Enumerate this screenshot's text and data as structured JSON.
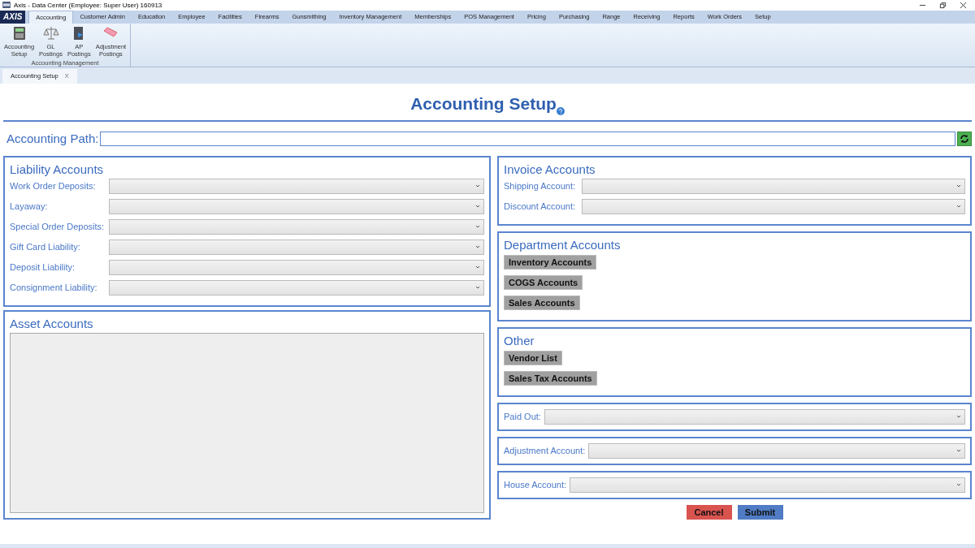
{
  "window": {
    "title": "Axis - Data Center  (Employee: Super User) 160913",
    "logo": "AXIS"
  },
  "menu_tabs": [
    {
      "label": "Accounting",
      "selected": true
    },
    {
      "label": "Customer Admin",
      "selected": false
    },
    {
      "label": "Education",
      "selected": false
    },
    {
      "label": "Employee",
      "selected": false
    },
    {
      "label": "Facilities",
      "selected": false
    },
    {
      "label": "Firearms",
      "selected": false
    },
    {
      "label": "Gunsmithing",
      "selected": false
    },
    {
      "label": "Inventory Management",
      "selected": false
    },
    {
      "label": "Memberships",
      "selected": false
    },
    {
      "label": "POS Management",
      "selected": false
    },
    {
      "label": "Pricing",
      "selected": false
    },
    {
      "label": "Purchasing",
      "selected": false
    },
    {
      "label": "Range",
      "selected": false
    },
    {
      "label": "Receiving",
      "selected": false
    },
    {
      "label": "Reports",
      "selected": false
    },
    {
      "label": "Work Orders",
      "selected": false
    },
    {
      "label": "Setup",
      "selected": false
    }
  ],
  "ribbon": {
    "group_label": "Accounting Management",
    "buttons": [
      {
        "kind": "calculator",
        "label": "Accounting\nSetup"
      },
      {
        "kind": "scale",
        "label": "GL\nPostings"
      },
      {
        "kind": "book",
        "label": "AP\nPostings"
      },
      {
        "kind": "eraser",
        "label": "Adjustment\nPostings"
      }
    ]
  },
  "document_tabs": [
    {
      "label": "Accounting Setup",
      "close": "X",
      "selected": true
    }
  ],
  "page_title": "Accounting Setup",
  "accounting_path": {
    "label": "Accounting Path:"
  },
  "liability_accounts": {
    "title": "Liability Accounts",
    "fields": [
      "Work Order Deposits:",
      "Layaway:",
      "Special Order Deposits:",
      "Gift Card Liability:",
      "Deposit Liability:",
      "Consignment Liability:"
    ]
  },
  "asset_accounts": {
    "title": "Asset Accounts"
  },
  "invoice_accounts": {
    "title": "Invoice Accounts",
    "fields": [
      "Shipping Account:",
      "Discount Account:"
    ]
  },
  "department_accounts": {
    "title": "Department Accounts",
    "buttons": [
      "Inventory Accounts",
      "COGS Accounts",
      "Sales Accounts"
    ]
  },
  "other": {
    "title": "Other",
    "buttons": [
      "Vendor List",
      "Sales Tax Accounts"
    ]
  },
  "single_fields": [
    "Paid Out:",
    "Adjustment Account:",
    "House Account:"
  ],
  "actions": [
    {
      "kind": "cancel",
      "label": "Cancel"
    },
    {
      "kind": "submit",
      "label": "Submit"
    }
  ]
}
